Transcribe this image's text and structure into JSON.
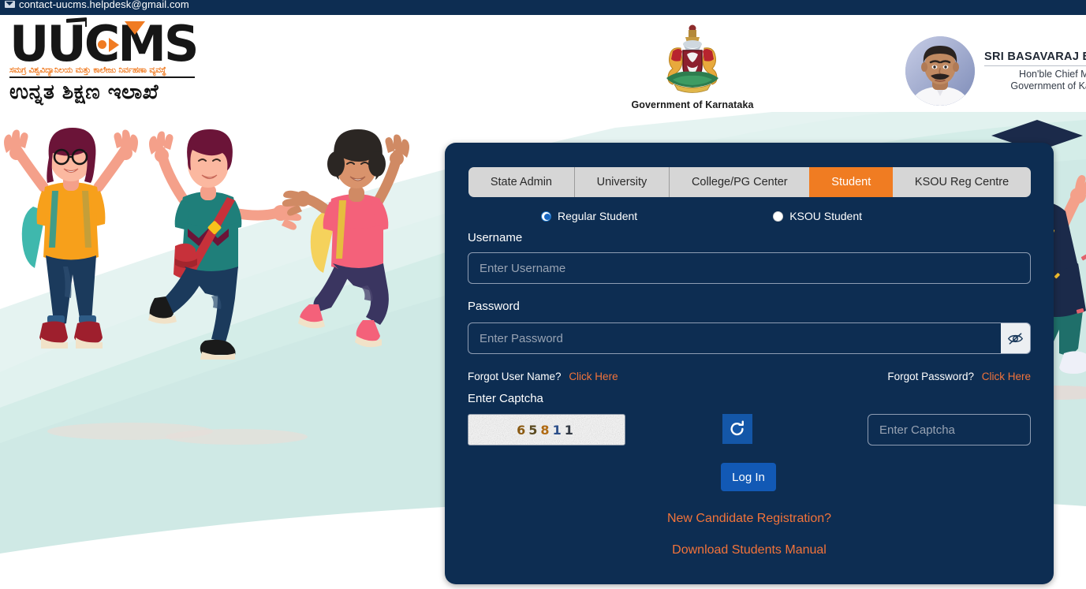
{
  "topbar": {
    "email": "contact-uucms.helpdesk@gmail.com",
    "mail_icon": "envelope-icon"
  },
  "header": {
    "logo": {
      "wordmark": "UUCMS",
      "kannada_tagline": "ಸಮಗ್ರ ವಿಶ್ವವಿದ್ಯಾನಿಲಯ ಮತ್ತು ಕಾಲೇಜು ನಿರ್ವಹಣಾ ವ್ಯವಸ್ಥೆ",
      "kannada_dept": "ಉನ್ನತ ಶಿಕ್ಷಣ ಇಲಾಖೆ"
    },
    "emblem": {
      "icon": "karnataka-state-emblem-icon",
      "caption": "Government of Karnataka"
    },
    "chief_minister": {
      "photo_icon": "chief-minister-portrait",
      "name": "SRI BASAVARAJ BOMMAI",
      "role": "Hon'ble Chief Minister",
      "government": "Government of Karnataka"
    }
  },
  "login": {
    "tabs": [
      {
        "label": "State Admin",
        "active": false
      },
      {
        "label": "University",
        "active": false
      },
      {
        "label": "College/PG Center",
        "active": false
      },
      {
        "label": "Student",
        "active": true
      },
      {
        "label": "KSOU Reg Centre",
        "active": false
      }
    ],
    "student_type": [
      {
        "label": "Regular Student",
        "selected": true
      },
      {
        "label": "KSOU Student",
        "selected": false
      }
    ],
    "username": {
      "label": "Username",
      "value": "",
      "placeholder": "Enter Username"
    },
    "password": {
      "label": "Password",
      "value": "",
      "placeholder": "Enter Password",
      "toggle_icon": "eye-slash-icon"
    },
    "forgot_username": {
      "text": "Forgot User Name?",
      "link": "Click Here"
    },
    "forgot_password": {
      "text": "Forgot Password?",
      "link": "Click Here"
    },
    "captcha": {
      "label": "Enter Captcha",
      "code": "65811",
      "refresh_icon": "refresh-icon",
      "input_value": "",
      "input_placeholder": "Enter Captcha"
    },
    "submit_label": "Log In",
    "new_registration": "New Candidate Registration?",
    "download_manual": "Download Students Manual"
  },
  "colors": {
    "header_navy": "#0d2d52",
    "panel_navy": "#0d2d52",
    "accent_orange": "#f07c22",
    "link_orange": "#f2733a",
    "button_blue": "#1259b5",
    "tab_grey": "#d6d6d6",
    "bg_teal": "#cdeae4"
  },
  "illustration": {
    "left": "three-celebrating-students-illustration",
    "right": "graduate-with-confetti-illustration"
  }
}
